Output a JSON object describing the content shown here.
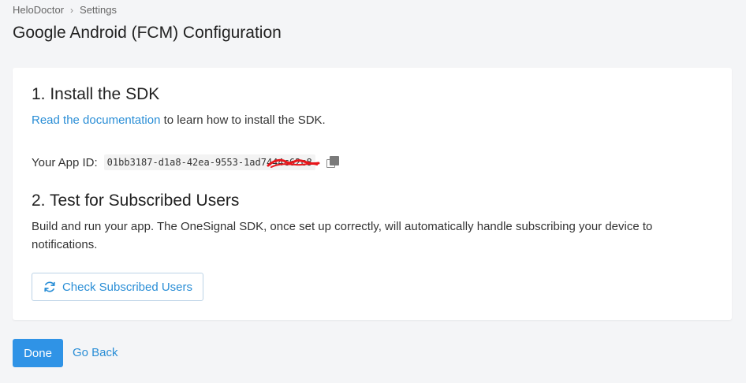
{
  "breadcrumb": {
    "items": [
      "HeloDoctor",
      "Settings"
    ],
    "separator": "›"
  },
  "page_title": "Google Android (FCM) Configuration",
  "section1": {
    "title": "1. Install the SDK",
    "doc_link": "Read the documentation",
    "doc_suffix": " to learn how to install the SDK.",
    "app_id_label": "Your App ID:",
    "app_id_value": "01bb3187-d1a8-42ea-9553-1ad7444c62c8",
    "copy_icon": "copy-icon"
  },
  "section2": {
    "title": "2. Test for Subscribed Users",
    "description": "Build and run your app. The OneSignal SDK, once set up correctly, will automatically handle subscribing your device to notifications.",
    "check_button": "Check Subscribed Users",
    "check_icon": "refresh-icon"
  },
  "footer": {
    "done_label": "Done",
    "back_label": "Go Back"
  },
  "colors": {
    "accent": "#2a8ed6",
    "primary_button": "#2f93e6",
    "background": "#f4f5f7",
    "redaction": "#e8161b"
  }
}
